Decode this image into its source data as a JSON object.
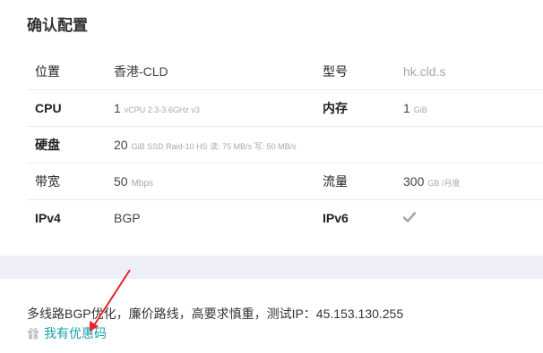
{
  "title": "确认配置",
  "specs": {
    "location_label": "位置",
    "location_value": "香港-CLD",
    "model_label": "型号",
    "model_value": "hk.cld.s",
    "cpu_label": "CPU",
    "cpu_value": "1",
    "cpu_detail": "vCPU 2.3-3.6GHz v3",
    "mem_label": "内存",
    "mem_value": "1",
    "mem_unit": "GiB",
    "disk_label": "硬盘",
    "disk_value": "20",
    "disk_detail": "GiB SSD Raid-10 HS 读: 75 MB/s 写: 50 MB/s",
    "bw_label": "带宽",
    "bw_value": "50",
    "bw_unit": "Mbps",
    "traffic_label": "流量",
    "traffic_value": "300",
    "traffic_unit": "GB /月度",
    "ipv4_label": "IPv4",
    "ipv4_value": "BGP",
    "ipv6_label": "IPv6",
    "ipv6_icon": "check-icon"
  },
  "notes": {
    "description": "多线路BGP优化，廉价路线，高要求慎重，测试IP：45.153.130.255",
    "coupon_label": "我有优惠码",
    "coupon_icon": "gift-icon"
  },
  "colors": {
    "accent": "#1aa1a8",
    "annotation_arrow": "#e5252a",
    "band": "#eeeff6"
  }
}
